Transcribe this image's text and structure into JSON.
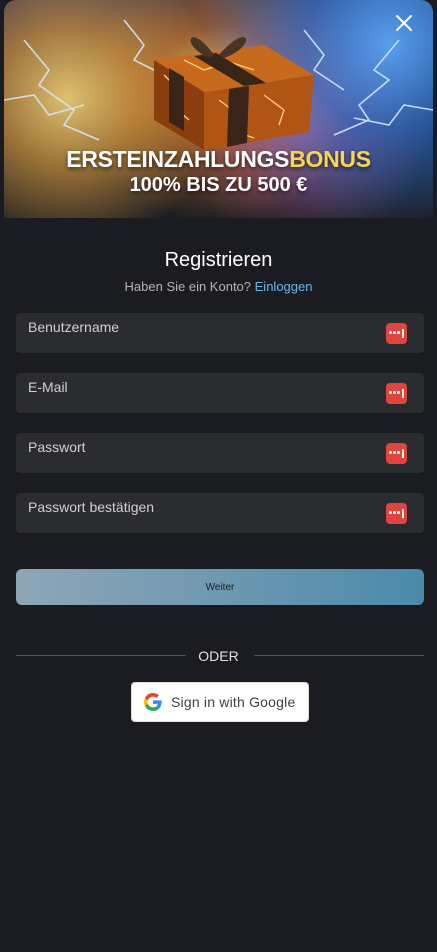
{
  "banner": {
    "title_main": "ERSTEINZAHLUNGS",
    "title_highlight": "BONUS",
    "subtitle": "100% BIS ZU 500 €",
    "close_icon": "close-icon"
  },
  "form": {
    "heading": "Registrieren",
    "have_account_text": "Haben Sie ein Konto?",
    "login_link": "Einloggen",
    "fields": [
      {
        "placeholder": "Benutzername",
        "value": ""
      },
      {
        "placeholder": "E-Mail",
        "value": ""
      },
      {
        "placeholder": "Passwort",
        "value": ""
      },
      {
        "placeholder": "Passwort bestätigen",
        "value": ""
      }
    ],
    "field_icon": "password-manager-icon",
    "submit_label": "Weiter"
  },
  "divider": {
    "label": "ODER"
  },
  "google": {
    "label": "Sign in with Google",
    "icon": "google-icon"
  },
  "colors": {
    "background": "#1b1c21",
    "field_bg": "#2b2c30",
    "link": "#6fb6e8",
    "bonus": "#f6d84a",
    "icon_red": "#e0443e"
  }
}
